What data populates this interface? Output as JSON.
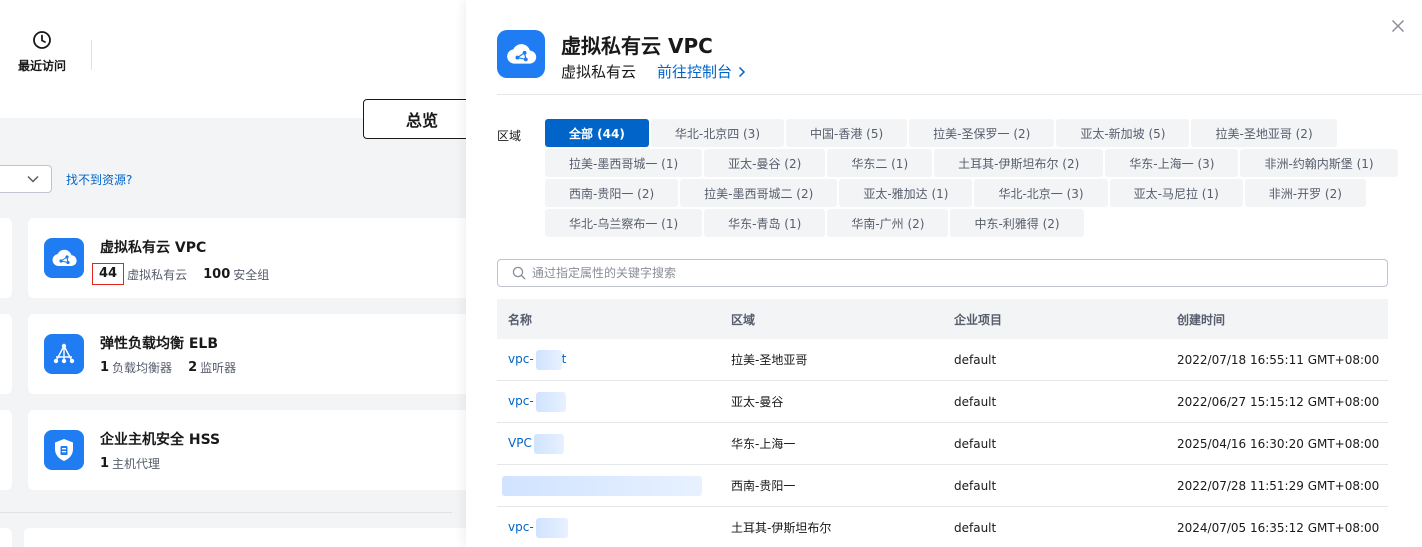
{
  "background": {
    "recent_label": "最近访问",
    "overview_button": "总览",
    "cant_find_link": "找不到资源?",
    "services": [
      {
        "title": "虚拟私有云 VPC",
        "icon": "cloud-vpc-icon",
        "stats": [
          {
            "num": "44",
            "label": "虚拟私有云"
          },
          {
            "num": "100",
            "label": "安全组"
          }
        ]
      },
      {
        "title": "弹性负载均衡 ELB",
        "icon": "load-balancer-icon",
        "stats": [
          {
            "num": "1",
            "label": "负载均衡器"
          },
          {
            "num": "2",
            "label": "监听器"
          }
        ]
      },
      {
        "title": "企业主机安全 HSS",
        "icon": "shield-icon",
        "stats": [
          {
            "num": "1",
            "label": "主机代理"
          }
        ]
      }
    ]
  },
  "panel": {
    "title": "虚拟私有云 VPC",
    "subtitle": "虚拟私有云",
    "console_link": "前往控制台",
    "region_label": "区域",
    "regions": [
      [
        "全部 (44)",
        "华北-北京四 (3)",
        "中国-香港 (5)",
        "拉美-圣保罗一 (2)",
        "亚太-新加坡 (5)",
        "拉美-圣地亚哥 (2)"
      ],
      [
        "拉美-墨西哥城一 (1)",
        "亚太-曼谷 (2)",
        "华东二 (1)",
        "土耳其-伊斯坦布尔 (2)",
        "华东-上海一 (3)",
        "非洲-约翰内斯堡 (1)"
      ],
      [
        "西南-贵阳一 (2)",
        "拉美-墨西哥城二 (2)",
        "亚太-雅加达 (1)",
        "华北-北京一 (3)",
        "亚太-马尼拉 (1)",
        "非洲-开罗 (2)"
      ],
      [
        "华北-乌兰察布一 (1)",
        "华东-青岛 (1)",
        "华南-广州 (2)",
        "中东-利雅得 (2)"
      ]
    ],
    "search_placeholder": "通过指定属性的关键字搜索",
    "columns": [
      "名称",
      "区域",
      "企业项目",
      "创建时间"
    ],
    "rows": [
      {
        "name": "vpc-",
        "name_tail": "t",
        "region": "拉美-圣地亚哥",
        "project": "default",
        "created": "2022/07/18 16:55:11 GMT+08:00"
      },
      {
        "name": "vpc-",
        "name_tail": "",
        "region": "亚太-曼谷",
        "project": "default",
        "created": "2022/06/27 15:15:12 GMT+08:00"
      },
      {
        "name": "VPC",
        "name_tail": "",
        "region": "华东-上海一",
        "project": "default",
        "created": "2025/04/16 16:30:20 GMT+08:00"
      },
      {
        "name": "",
        "name_tail": "",
        "region": "西南-贵阳一",
        "project": "default",
        "created": "2022/07/28 11:51:29 GMT+08:00"
      },
      {
        "name": "vpc-",
        "name_tail": "",
        "region": "土耳其-伊斯坦布尔",
        "project": "default",
        "created": "2024/07/05 16:35:12 GMT+08:00"
      }
    ]
  }
}
